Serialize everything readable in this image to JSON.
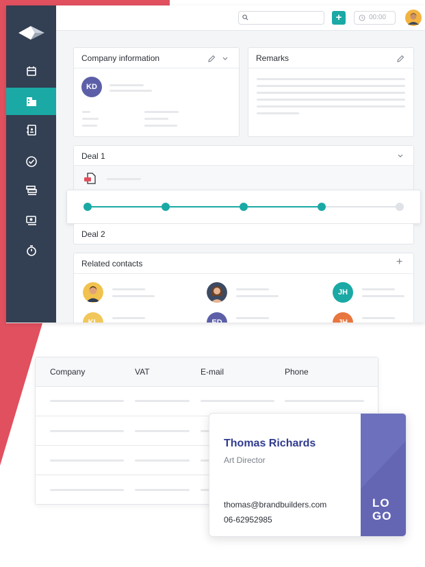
{
  "colors": {
    "accent_red": "#e1505f",
    "sidebar": "#333f52",
    "teal": "#1aa9a5",
    "purple": "#5c5fa8",
    "card_stripe": "#6466b4"
  },
  "topbar": {
    "search_icon": "search-icon",
    "add_label": "+",
    "timer": "00:00"
  },
  "sidebar": {
    "items": [
      {
        "icon": "calendar-icon"
      },
      {
        "icon": "company-icon",
        "active": true
      },
      {
        "icon": "address-book-icon"
      },
      {
        "icon": "check-circle-icon"
      },
      {
        "icon": "stack-icon"
      },
      {
        "icon": "money-icon"
      },
      {
        "icon": "stopwatch-icon"
      }
    ]
  },
  "company_info": {
    "title": "Company information",
    "avatar_initials": "KD"
  },
  "remarks": {
    "title": "Remarks"
  },
  "deals": [
    {
      "title": "Deal 1",
      "progress_steps_done": 4,
      "progress_steps_total": 5
    },
    {
      "title": "Deal 2"
    }
  ],
  "related_contacts": {
    "title": "Related contacts",
    "add_label": "+",
    "contacts": [
      {
        "initials": "JH",
        "color": "#1aa9a5"
      },
      {
        "initials": "KL",
        "color": "#f1c75b"
      },
      {
        "initials": "ED",
        "color": "#5c5fa8"
      },
      {
        "initials": "JH",
        "color": "#e8763f"
      }
    ]
  },
  "table": {
    "headers": [
      "Company",
      "VAT",
      "E-mail",
      "Phone"
    ]
  },
  "business_card": {
    "name": "Thomas Richards",
    "role": "Art Director",
    "email": "thomas@brandbuilders.com",
    "phone": "06-62952985",
    "logo_line1": "LO",
    "logo_line2": "GO"
  }
}
